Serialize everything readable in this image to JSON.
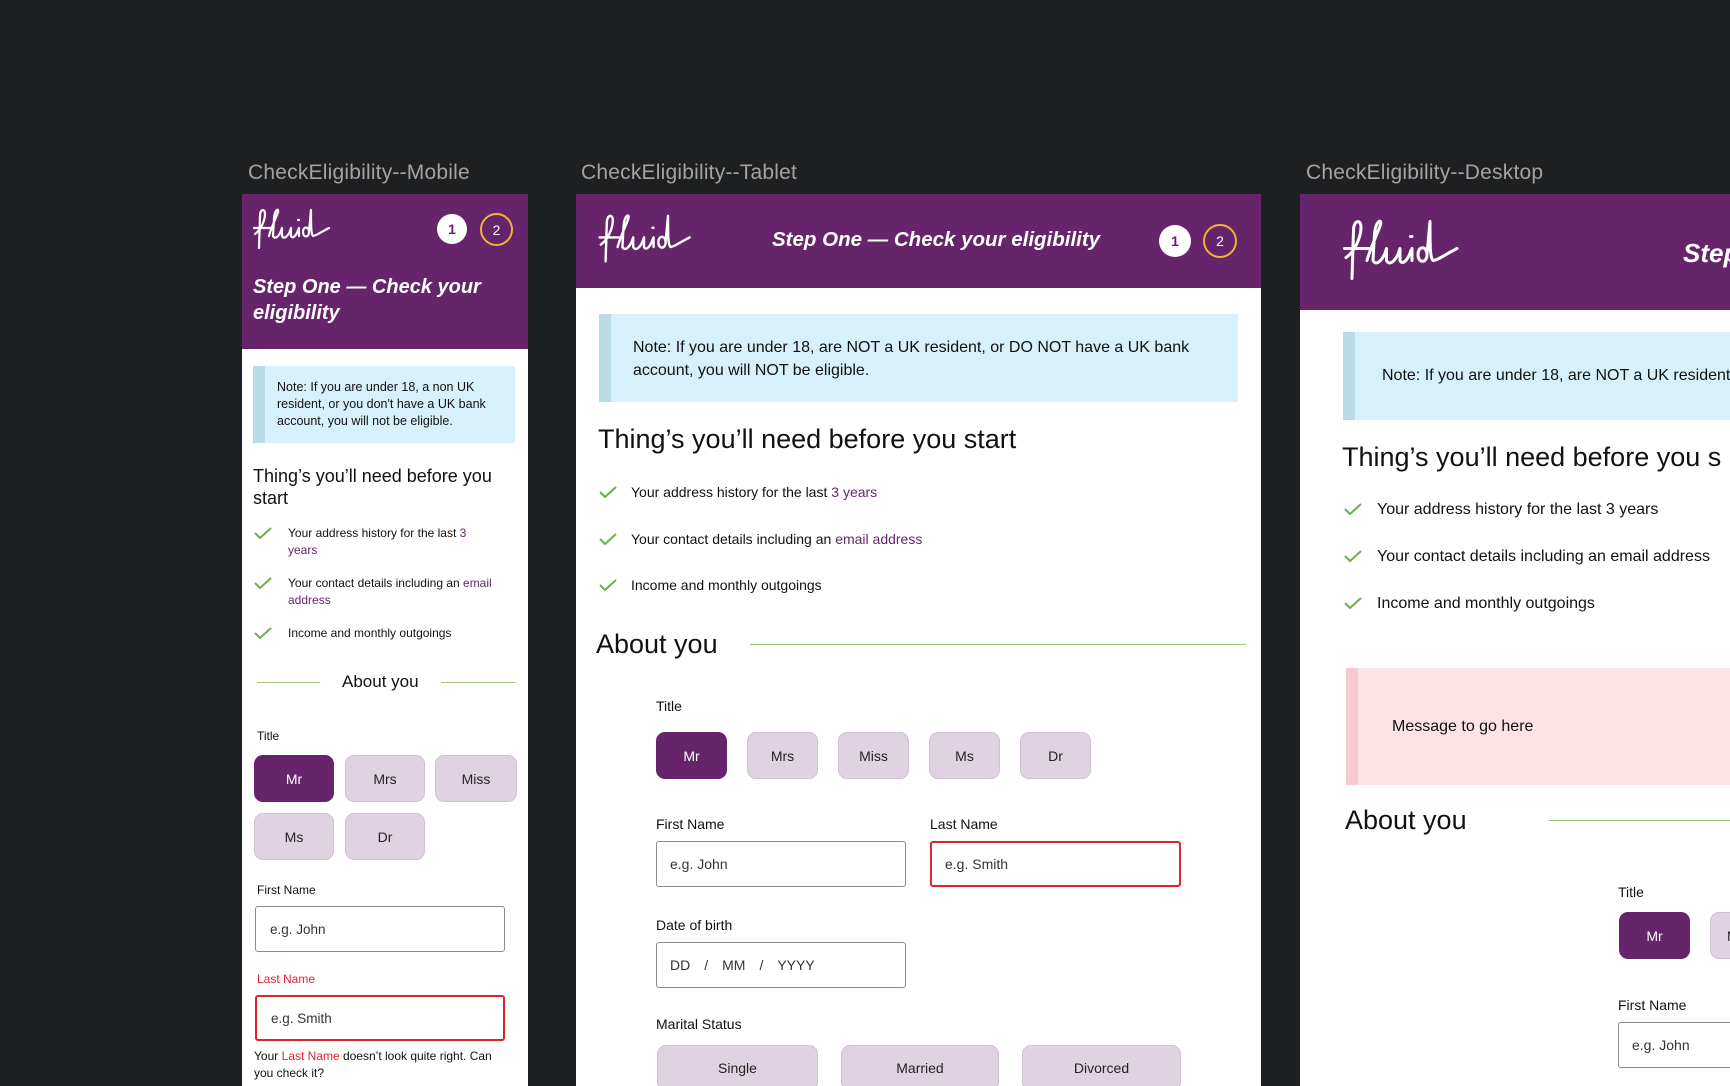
{
  "frames": {
    "mobile_label": "CheckEligibility--Mobile",
    "tablet_label": "CheckEligibility--Tablet",
    "desktop_label": "CheckEligibility--Desktop"
  },
  "brand": {
    "logo_text": "fluid",
    "primary": "#66256a",
    "accent_ring": "#f2b233",
    "check_green": "#6ab04c",
    "error_red": "#e0242e"
  },
  "steps": [
    "1",
    "2"
  ],
  "mobile": {
    "title_line1": "Step One — Check your",
    "title_line2": "eligibility",
    "note": "Note: If you are under 18, a non UK resident, or you don't have a UK bank account, you will not be eligible.",
    "need_heading_line1": "Thing’s you’ll need before you",
    "need_heading_line2": "start",
    "items": [
      {
        "pre": "Your address history for the last ",
        "hl": "3",
        "post": "",
        "line2": "years"
      },
      {
        "pre": "Your contact details including an ",
        "hl": "email",
        "post": "",
        "line2": "address"
      },
      {
        "pre": "Income and monthly outgoings",
        "hl": "",
        "post": "",
        "line2": ""
      }
    ],
    "about": "About you",
    "title_label": "Title",
    "titles": [
      "Mr",
      "Mrs",
      "Miss",
      "Ms",
      "Dr"
    ],
    "first_name_label": "First Name",
    "first_name_placeholder": "e.g. John",
    "last_name_label": "Last Name",
    "last_name_placeholder": "e.g. Smith",
    "error_pre": "Your ",
    "error_field": "Last Name",
    "error_post": " doesn’t look quite right. Can",
    "error_line2": "you check it?"
  },
  "tablet": {
    "title": "Step One — Check your eligibility",
    "note_line1": "Note: If you are under 18, are NOT a UK resident, or DO NOT have a UK bank",
    "note_line2": "account, you will NOT be eligible.",
    "need_heading": "Thing’s you’ll need before you start",
    "items": [
      {
        "pre": "Your address history for the last ",
        "hl": "3 years"
      },
      {
        "pre": "Your contact details including an ",
        "hl": "email address"
      },
      {
        "pre": "Income and monthly outgoings",
        "hl": ""
      }
    ],
    "about": "About you",
    "title_label": "Title",
    "titles": [
      "Mr",
      "Mrs",
      "Miss",
      "Ms",
      "Dr"
    ],
    "first_name_label": "First Name",
    "first_name_placeholder": "e.g. John",
    "last_name_label": "Last Name",
    "last_name_placeholder": "e.g. Smith",
    "dob_label": "Date of birth",
    "dob_dd": "DD",
    "dob_mm": "MM",
    "dob_yyyy": "YYYY",
    "dob_sep": "/",
    "marital_label": "Marital Status",
    "marital": [
      "Single",
      "Married",
      "Divorced"
    ]
  },
  "desktop": {
    "title_partial": "Step",
    "note": "Note: If you are under 18, are NOT a UK resident",
    "need_heading": "Thing’s you’ll need before you s",
    "items": [
      "Your address history for the last 3 years",
      "Your contact details including an email address",
      "Income and monthly outgoings"
    ],
    "message": "Message to go here",
    "about": "About you",
    "title_label": "Title",
    "title_selected": "Mr",
    "title_next_partial": "M",
    "first_name_label": "First Name",
    "first_name_placeholder": "e.g. John"
  }
}
